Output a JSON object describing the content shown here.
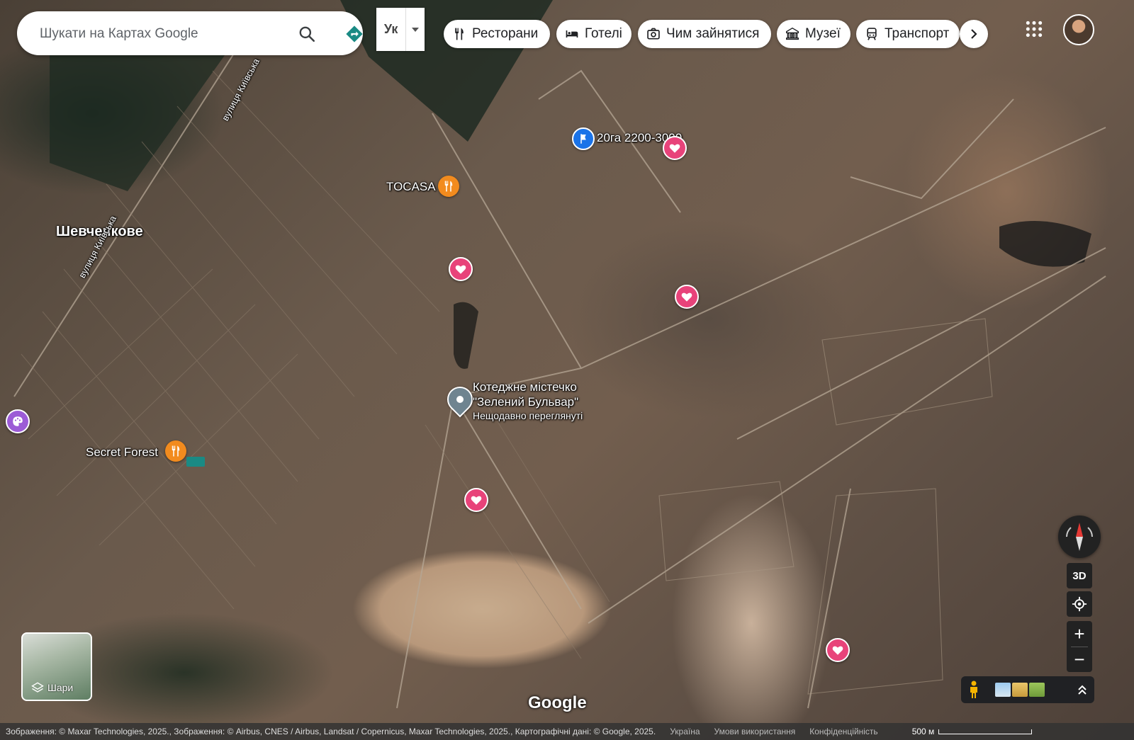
{
  "search": {
    "placeholder": "Шукати на Картах Google"
  },
  "language": {
    "label": "Ук"
  },
  "chips": [
    {
      "label": "Ресторани",
      "icon": "fork-knife-icon"
    },
    {
      "label": "Готелі",
      "icon": "bed-icon"
    },
    {
      "label": "Чим зайнятися",
      "icon": "camera-icon"
    },
    {
      "label": "Музеї",
      "icon": "museum-icon"
    },
    {
      "label": "Транспорт",
      "icon": "train-icon"
    }
  ],
  "map": {
    "town": "Шевченкове",
    "streets": [
      "вулиця Київська",
      "вулиця Київська"
    ],
    "pois": [
      {
        "label": "TOCASA",
        "type": "restaurant"
      },
      {
        "label": "Secret Forest",
        "type": "restaurant"
      },
      {
        "label": "20га 2200-3000",
        "type": "flag"
      },
      {
        "label": "Котеджне містечко",
        "label2": "\"Зелений Бульвар\"",
        "sub": "Нещодавно переглянуті",
        "type": "recent"
      }
    ]
  },
  "controls": {
    "btn3d": "3D"
  },
  "layers": {
    "label": "Шари"
  },
  "brand": "Google",
  "footer": {
    "attribution": "Зображення: © Maxar Technologies, 2025., Зображення: © Airbus, CNES / Airbus, Landsat / Copernicus, Maxar Technologies, 2025., Картографічні дані: © Google, 2025.",
    "country": "Україна",
    "terms": "Умови використання",
    "privacy": "Конфіденційність",
    "scale": "500 м"
  },
  "colors": {
    "restaurant": "#f28b1e",
    "favorite": "#e8437a",
    "flag": "#1a73e8",
    "recent": "#6f8490",
    "teal": "#1a8a84"
  }
}
